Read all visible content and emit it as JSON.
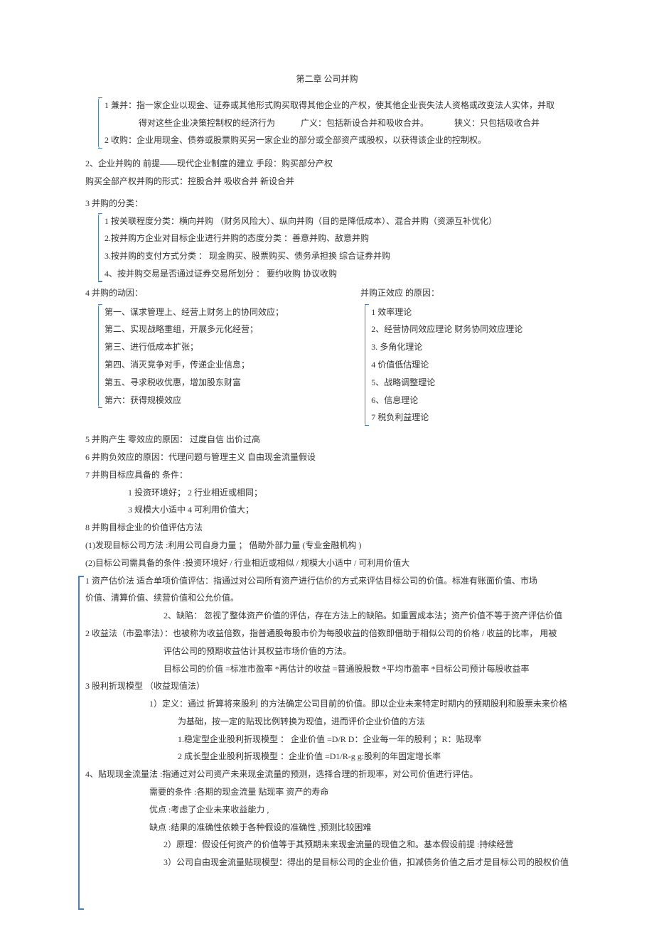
{
  "title": "第二章 公司并购",
  "p1": {
    "l1": "1 兼并：指一家企业以现金、证券或其他形式购买取得其他企业的产权，使其他企业丧失法人资格或改变法人实体，并取",
    "l2a": "得对这些企业决策控制权的经济行为",
    "l2b": "广义：包括新设合并和吸收合并。",
    "l2c": "狭义：只包括吸收合并",
    "l3": "2 收购：企业用现金、债券或股票购买另一家企业的部分或全部资产或股权，以获得该企业的控制权。"
  },
  "p2a": "2、企业并购的   前提——现代企业制度的建立  手段：购买部分产权",
  "p2b": "购买全部产权并购的形式：控股合并 吸收合并 新设合并",
  "s3": "3 并购的分类：",
  "category": {
    "l1": "1 按关联程度分类：横向并购     （财务风险大）、纵向并购（目的是降低成本）、混合并购（资源互补优化）",
    "l2": "2.按并购方企业对目标企业进行并购的态度分类     ：善意并购、敌意并购",
    "l3": "3.按并购的支付方式分类  ：  现金购买、股票购买、债务承担换     综合证券并购",
    "l4": "4、按并购交易是否通过证券交易所划分  ：     要约收购         协议收购"
  },
  "s4": "4 并购的动因：",
  "s4r": "并购正效应 的原因：",
  "motives": {
    "l1": "第一、谋求管理上、经营上财务上的协同效应；",
    "l2": "第二、实现战略重组，开展多元化经营；",
    "l3": "第三、进行低成本扩张；",
    "l4": "第四、消灭竞争对手，传递企业信息；",
    "l5": "第五、寻求税收优惠，增加股东财富",
    "l6": "第六：获得规模效应"
  },
  "reasons": {
    "r1": "1 效率理论",
    "r2": "2、经营协同效应理论         财务协同效应理论",
    "r3": "3. 多角化理论",
    "r4": "4 价值低估理论",
    "r5": "5、战略调整理论",
    "r6": "6、信息理论",
    "r7": "7 税负利益理论"
  },
  "s5": "5 并购产生 零效应的原因：     过度自信    出价过高",
  "s6": "6 并购负效应的原因：代理问题与管理主义           自由现金流量假设",
  "s7": "7 并购目标应具备的 条件：",
  "s7a": "1 投资环境好；       2 行业相近或相同；",
  "s7b": "3 规模大小适中       4 可利用价值大；",
  "s8": "8    并购目标企业的价值评估方法",
  "s8a": "(1)发现目标公司方法 :利用公司自身力量 ；      借助外部力量 (专业金融机构 )",
  "s8b": "(2)目标公司需具备的条件  :投资环境好 / 行业相近或相似 / 规模大小适中 / 可利用价值大",
  "m1a": "1 资产估价法          适合单项价值评估：指通过对公司所有资产进行估价的方式来评估目标公司的价值。标准有账面价值、市场",
  "m1b": "价值、清算价值、续营价值和公允价值。",
  "m1c": "2、缺陷：      忽视了整体资产价值的评估，存在方法上的缺陷。如重置成本法；资产价值不等于资产评估价值",
  "m2a": "2 收益法（市盈率法）：也被称为收益倍数，指普通股每股市价为每股收益的倍数即借助于相似公司的价格        / 收益的比率，   用被",
  "m2b": "评估公司的预期收益估计其权益市场价值的方法。",
  "m2c": "目标公司的价值 =标准市盈率 *再估计的收益     =普通股股数 *平均市盈率 *目标公司预计每股收益率",
  "m3": "3 股利折现模型   （收益现值法）",
  "m3a": "1）定义：通过 折算将来股利 的方法确定公司目前的价值。即以企业未来特定时期内的预期股利和股票未来价格",
  "m3b": "为基础，按一定的贴现比例转换为现值，进而评价企业价值的方法",
  "m3c": "1.稳定型企业股利折现模型  ：  企业价值 =D/R      D：企业每一年的股利       ；R：贴现率",
  "m3d": "2 成长型企业股利折现模型  ：企业价值 =D1/R-g      g:股利的年固定增长率",
  "m4": "4、贴现现金流量法 :指通过对公司资产未来现金流量的预测，选择合理的折现率，对公司价值进行评估。",
  "m4a": "需要的条件 :各期的现金流量     贴现率    资产的寿命",
  "m4b": "优点 :考虑了企业未来收益能力 ,",
  "m4c": "缺点 :结果的准确性依赖于各种假设的准确性   ,预测比较困难",
  "m4d": "2）原理：假设任何资产的价值等于其预期未来现金流量的现值之和。基本假设前提          :持续经营",
  "m4e": "3）公司自由现金流量贴现模型：得出的是目标公司的企业价值，扣减债务价值之后才是目标公司的股权价值"
}
